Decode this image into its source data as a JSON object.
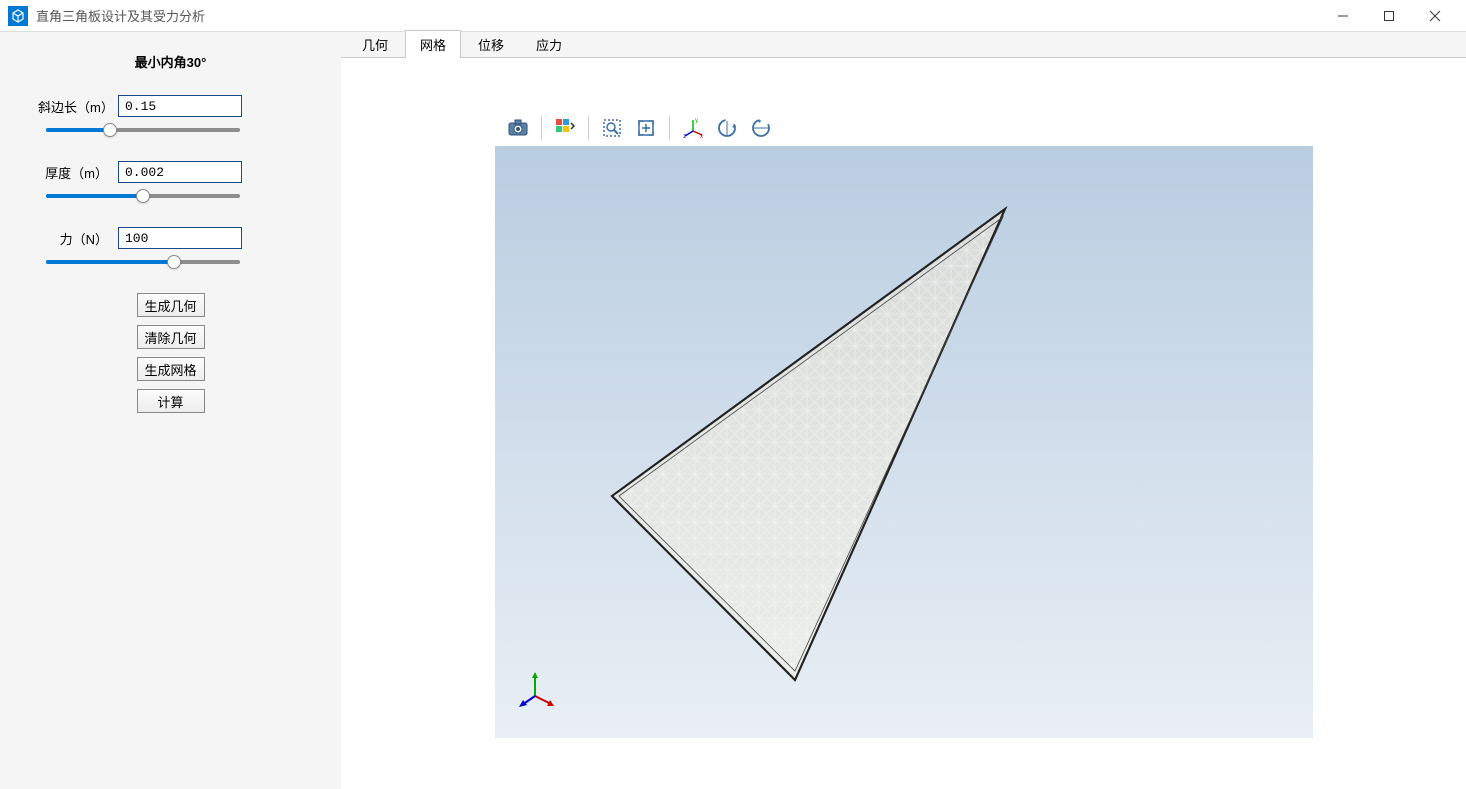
{
  "title": "直角三角板设计及其受力分析",
  "sidebar": {
    "title": "最小内角30°",
    "fields": {
      "hypotenuse": {
        "label": "斜边长（m）",
        "value": "0.15",
        "slider_pct": 33
      },
      "thickness": {
        "label": "厚度（m）",
        "value": "0.002",
        "slider_pct": 50
      },
      "force": {
        "label": "力（N）",
        "value": "100",
        "slider_pct": 66
      }
    },
    "buttons": {
      "gen_geom": "生成几何",
      "clear_geom": "清除几何",
      "gen_mesh": "生成网格",
      "compute": "计算"
    }
  },
  "tabs": {
    "geometry": "几何",
    "mesh": "网格",
    "displacement": "位移",
    "stress": "应力",
    "active": "mesh"
  },
  "toolbar_icons": {
    "camera": "camera-icon",
    "box": "isometric-icon",
    "zoomwin": "zoom-window-icon",
    "fit": "zoom-fit-icon",
    "axes": "axes-icon",
    "rotate_h": "rotate-horizontal-icon",
    "rotate_v": "rotate-vertical-icon"
  }
}
